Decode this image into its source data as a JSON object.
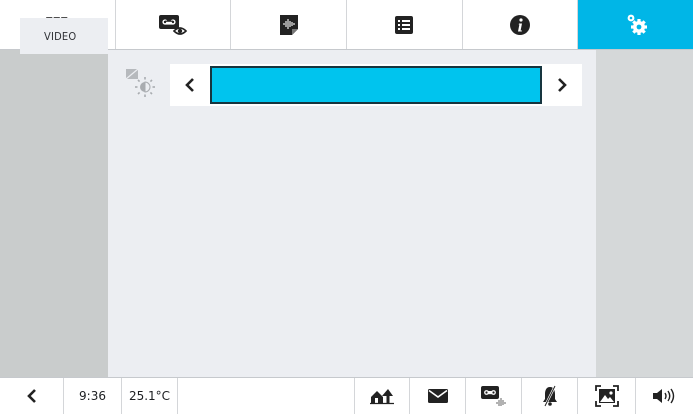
{
  "topbar": {
    "tabs": [
      {
        "icon": "apps-grid-icon"
      },
      {
        "icon": "voicemail-view-icon"
      },
      {
        "icon": "audio-message-icon"
      },
      {
        "icon": "list-icon"
      },
      {
        "icon": "info-icon"
      },
      {
        "icon": "settings-gears-icon",
        "active": true
      }
    ]
  },
  "sidebar": {
    "items": [
      {
        "label": "VIDEO",
        "selected": true
      }
    ]
  },
  "setting": {
    "icon": "brightness-contrast-icon",
    "level": 1.0
  },
  "statusbar": {
    "time": "9:36",
    "temperature": "25.1°C",
    "icons": [
      "back-icon",
      "home-away-icon",
      "mail-icon",
      "voicemail-record-icon",
      "mute-bell-icon",
      "fullscreen-picture-icon",
      "speaker-volume-icon"
    ]
  },
  "colors": {
    "accent": "#00b6e7",
    "bar_fill": "#00c4ee",
    "bar_border": "#16353f",
    "panel": "#eceef2",
    "sidebar": "#c9cccc"
  }
}
